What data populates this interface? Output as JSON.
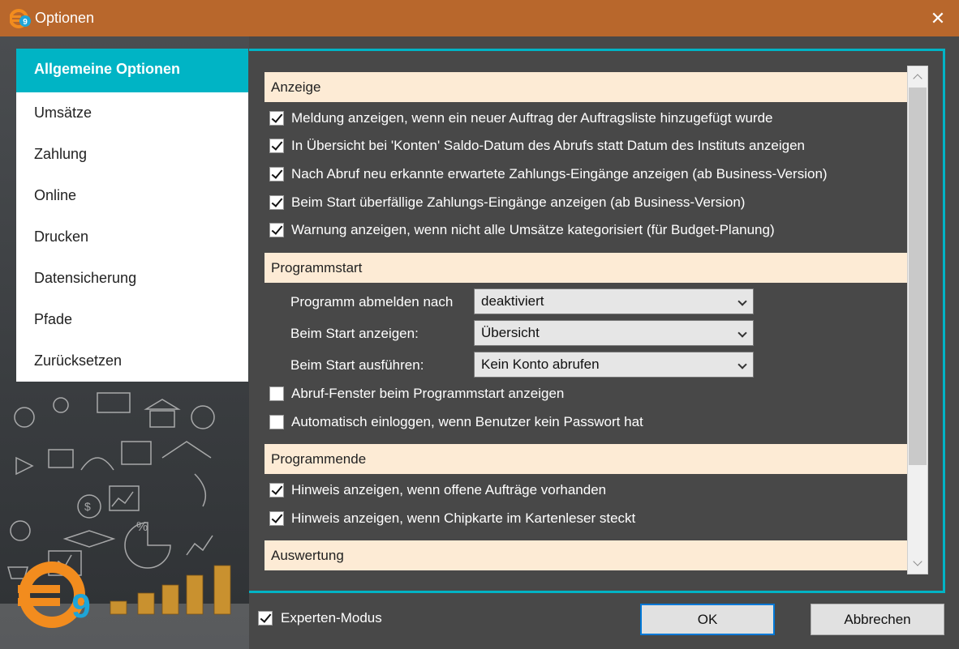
{
  "window": {
    "title": "Optionen",
    "close_glyph": "✕",
    "icon": "euro9-logo-icon"
  },
  "sidebar": {
    "items": [
      {
        "label": "Allgemeine Optionen",
        "active": true
      },
      {
        "label": "Umsätze"
      },
      {
        "label": "Zahlung"
      },
      {
        "label": "Online"
      },
      {
        "label": "Drucken"
      },
      {
        "label": "Datensicherung"
      },
      {
        "label": "Pfade"
      },
      {
        "label": "Zurücksetzen"
      }
    ],
    "logo_text": "€9"
  },
  "sections": {
    "anzeige": {
      "title": "Anzeige",
      "options": [
        {
          "label": "Meldung anzeigen, wenn ein neuer Auftrag der Auftragsliste hinzugefügt wurde",
          "checked": true
        },
        {
          "label": "In Übersicht bei 'Konten' Saldo-Datum des Abrufs statt Datum des Instituts anzeigen",
          "checked": true
        },
        {
          "label": "Nach Abruf neu erkannte erwartete Zahlungs-Eingänge anzeigen (ab Business-Version)",
          "checked": true
        },
        {
          "label": "Beim Start überfällige Zahlungs-Eingänge anzeigen (ab Business-Version)",
          "checked": true
        },
        {
          "label": "Warnung anzeigen, wenn nicht alle Umsätze kategorisiert (für Budget-Planung)",
          "checked": true
        }
      ]
    },
    "programmstart": {
      "title": "Programmstart",
      "fields": [
        {
          "label": "Programm abmelden nach",
          "value": "deaktiviert"
        },
        {
          "label": "Beim Start anzeigen:",
          "value": "Übersicht"
        },
        {
          "label": "Beim Start ausführen:",
          "value": "Kein Konto abrufen"
        }
      ],
      "options": [
        {
          "label": "Abruf-Fenster beim Programmstart anzeigen",
          "checked": false
        },
        {
          "label": "Automatisch einloggen, wenn Benutzer kein Passwort hat",
          "checked": false
        }
      ]
    },
    "programmende": {
      "title": "Programmende",
      "options": [
        {
          "label": "Hinweis anzeigen, wenn offene Aufträge vorhanden",
          "checked": true
        },
        {
          "label": "Hinweis anzeigen, wenn Chipkarte im Kartenleser steckt",
          "checked": true
        }
      ]
    },
    "auswertung": {
      "title": "Auswertung"
    }
  },
  "footer": {
    "expert_mode": {
      "label": "Experten-Modus",
      "checked": true
    },
    "ok_label": "OK",
    "cancel_label": "Abbrechen"
  },
  "colors": {
    "titlebar": "#b8672c",
    "accent": "#00b4c5",
    "section_bg": "#fdebd5",
    "content_bg": "#484848"
  }
}
